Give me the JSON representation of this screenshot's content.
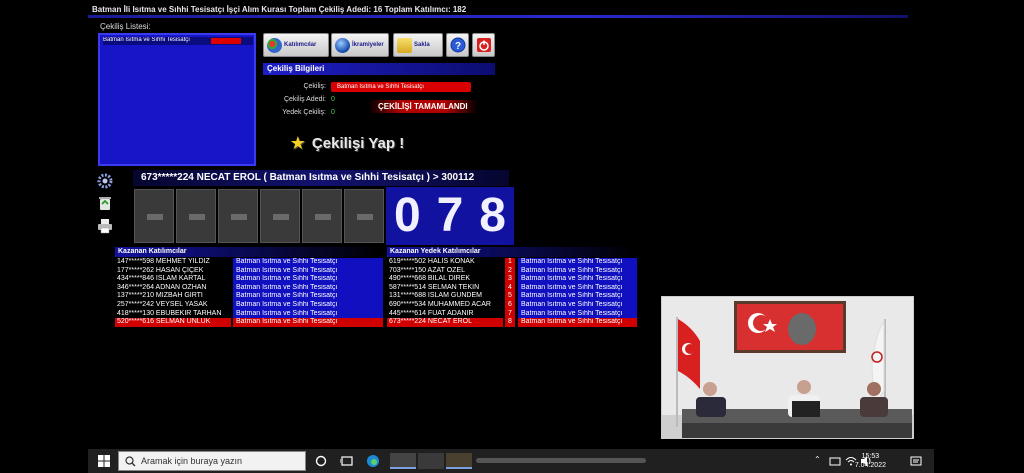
{
  "header": {
    "title": "Batman İli Isıtma ve Sıhhi Tesisatçı İşçi Alım Kurası   Toplam Çekiliş Adedi: 16   Toplam Katılımcı: 182"
  },
  "list": {
    "label": "Çekiliş Listesi:",
    "items": [
      {
        "label": "Batman Isıtma ve Sıhhi Tesisatçı"
      }
    ]
  },
  "toolbar": {
    "participants_label": "Katılımcılar",
    "prizes_label": "İkramiyeler",
    "save_label": "Sakla"
  },
  "info": {
    "header": "Çekiliş Bilgileri",
    "cekilis_label": "Çekiliş:",
    "cekilis_value": "Batman Isıtma ve Sıhhi Tesisatçı",
    "adet_label": "Çekiliş Adedi:",
    "adet_value": "0",
    "yedek_label": "Yedek Çekiliş:",
    "yedek_value": "0",
    "status": "ÇEKİLİŞİ TAMAMLANDI"
  },
  "draw": {
    "label": "Çekilişi Yap !"
  },
  "winner": {
    "text": "673*****224 NECAT EROL    ( Batman Isıtma ve Sıhhi Tesisatçı )    > 300112"
  },
  "digits": [
    "0",
    "7",
    "8"
  ],
  "winners": {
    "header": "Kazanan Katılımcılar",
    "rows": [
      {
        "name": "147*****598 MEHMET YILDIZ",
        "inst": "Batman Isıtma ve Sıhhi Tesisatçı"
      },
      {
        "name": "177*****262 HASAN ÇİÇEK",
        "inst": "Batman Isıtma ve Sıhhi Tesisatçı"
      },
      {
        "name": "434*****846 İSLAM KARTAL",
        "inst": "Batman Isıtma ve Sıhhi Tesisatçı"
      },
      {
        "name": "346*****264 ADNAN ÖZHAN",
        "inst": "Batman Isıtma ve Sıhhi Tesisatçı"
      },
      {
        "name": "137*****210 MİZBAH GİRTİ",
        "inst": "Batman Isıtma ve Sıhhi Tesisatçı"
      },
      {
        "name": "257*****242 VEYSEL YASAK",
        "inst": "Batman Isıtma ve Sıhhi Tesisatçı"
      },
      {
        "name": "418*****130 EBUBEKİR TARHAN",
        "inst": "Batman Isıtma ve Sıhhi Tesisatçı"
      },
      {
        "name": "520*****616 SELMAN ÜNLÜK",
        "inst": "Batman Isıtma ve Sıhhi Tesisatçı"
      }
    ]
  },
  "reserves": {
    "header": "Kazanan Yedek Katılımcılar",
    "rows": [
      {
        "name": "619*****502 HALİS KONAK",
        "no": "1",
        "inst": "Batman Isıtma ve Sıhhi Tesisatçı"
      },
      {
        "name": "703*****150 AZAT ÖZEL",
        "no": "2",
        "inst": "Batman Isıtma ve Sıhhi Tesisatçı"
      },
      {
        "name": "490*****668 BİLAL DİREK",
        "no": "3",
        "inst": "Batman Isıtma ve Sıhhi Tesisatçı"
      },
      {
        "name": "587*****514 SELMAN TEKİN",
        "no": "4",
        "inst": "Batman Isıtma ve Sıhhi Tesisatçı"
      },
      {
        "name": "131*****688 İSLAM GÜNDEM",
        "no": "5",
        "inst": "Batman Isıtma ve Sıhhi Tesisatçı"
      },
      {
        "name": "690*****534 MUHAMMED ACAR",
        "no": "6",
        "inst": "Batman Isıtma ve Sıhhi Tesisatçı"
      },
      {
        "name": "445*****614 FUAT ADANIR",
        "no": "7",
        "inst": "Batman Isıtma ve Sıhhi Tesisatçı"
      },
      {
        "name": "673*****224 NECAT EROL",
        "no": "8",
        "inst": "Batman Isıtma ve Sıhhi Tesisatçı"
      }
    ]
  },
  "taskbar": {
    "search_placeholder": "Aramak için buraya yazın",
    "time": "15:53",
    "date": "7.04.2022"
  },
  "colors": {
    "background": "#000000",
    "panel_blue": "#1616c8",
    "alert_red": "#d00000",
    "value_green": "#4fd04f"
  }
}
